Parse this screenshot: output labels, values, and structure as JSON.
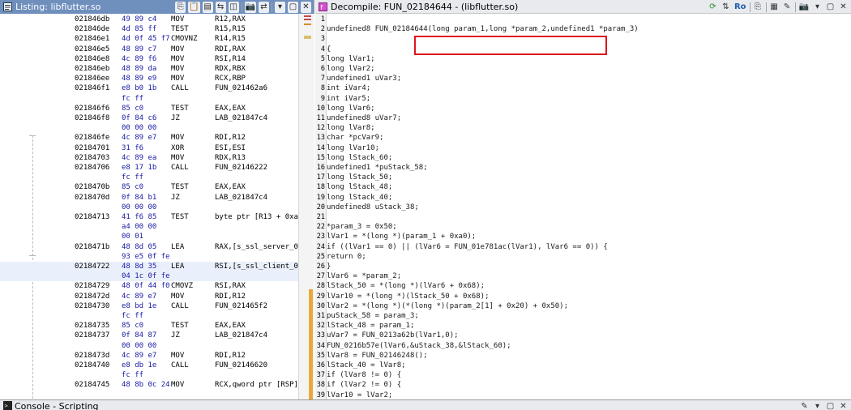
{
  "listing": {
    "title": "Listing:  libflutter.so",
    "rows": [
      {
        "addr": "021846db",
        "bytes": "49 89 c4",
        "mn": "MOV",
        "op": "R12,RAX"
      },
      {
        "addr": "021846de",
        "bytes": "4d 85 ff",
        "mn": "TEST",
        "op": "R15,R15"
      },
      {
        "addr": "021846e1",
        "bytes": "4d 0f 45 f7",
        "mn": "CMOVNZ",
        "op": "R14,R15"
      },
      {
        "addr": "021846e5",
        "bytes": "48 89 c7",
        "mn": "MOV",
        "op": "RDI,RAX"
      },
      {
        "addr": "021846e8",
        "bytes": "4c 89 f6",
        "mn": "MOV",
        "op": "RSI,R14"
      },
      {
        "addr": "021846eb",
        "bytes": "48 89 da",
        "mn": "MOV",
        "op": "RDX,RBX"
      },
      {
        "addr": "021846ee",
        "bytes": "48 89 e9",
        "mn": "MOV",
        "op": "RCX,RBP"
      },
      {
        "addr": "021846f1",
        "bytes": "e8 b0 1b",
        "mn": "CALL",
        "op": "FUN_021462a6"
      },
      {
        "addr": "",
        "bytes": "fc ff",
        "mn": "",
        "op": ""
      },
      {
        "addr": "021846f6",
        "bytes": "85 c0",
        "mn": "TEST",
        "op": "EAX,EAX"
      },
      {
        "addr": "021846f8",
        "bytes": "0f 84 c6",
        "mn": "JZ",
        "op": "LAB_021847c4"
      },
      {
        "addr": "",
        "bytes": "00 00 00",
        "mn": "",
        "op": ""
      },
      {
        "addr": "021846fe",
        "bytes": "4c 89 e7",
        "mn": "MOV",
        "op": "RDI,R12"
      },
      {
        "addr": "02184701",
        "bytes": "31 f6",
        "mn": "XOR",
        "op": "ESI,ESI"
      },
      {
        "addr": "02184703",
        "bytes": "4c 89 ea",
        "mn": "MOV",
        "op": "RDX,R13"
      },
      {
        "addr": "02184706",
        "bytes": "e8 17 1b",
        "mn": "CALL",
        "op": "FUN_02146222"
      },
      {
        "addr": "",
        "bytes": "fc ff",
        "mn": "",
        "op": ""
      },
      {
        "addr": "0218470b",
        "bytes": "85 c0",
        "mn": "TEST",
        "op": "EAX,EAX"
      },
      {
        "addr": "0218470d",
        "bytes": "0f 84 b1",
        "mn": "JZ",
        "op": "LAB_021847c4"
      },
      {
        "addr": "",
        "bytes": "00 00 00",
        "mn": "",
        "op": ""
      },
      {
        "addr": "02184713",
        "bytes": "41 f6 85",
        "mn": "TEST",
        "op": "byte ptr [R13 + 0xa4],"
      },
      {
        "addr": "",
        "bytes": "a4 00 00",
        "mn": "",
        "op": ""
      },
      {
        "addr": "",
        "bytes": "00 01",
        "mn": "",
        "op": ""
      },
      {
        "addr": "0218471b",
        "bytes": "48 8d 05",
        "mn": "LEA",
        "op": "RAX,[s_ssl_server_0028"
      },
      {
        "addr": "",
        "bytes": "93 e5 0f fe",
        "mn": "",
        "op": ""
      },
      {
        "addr": "02184722",
        "bytes": "48 8d 35",
        "mn": "LEA",
        "op": "RSI,[s_ssl_client_0027"
      },
      {
        "addr": "",
        "bytes": "04 1c 0f fe",
        "mn": "",
        "op": ""
      },
      {
        "addr": "02184729",
        "bytes": "48 0f 44 f0",
        "mn": "CMOVZ",
        "op": "RSI,RAX"
      },
      {
        "addr": "0218472d",
        "bytes": "4c 89 e7",
        "mn": "MOV",
        "op": "RDI,R12"
      },
      {
        "addr": "02184730",
        "bytes": "e8 bd 1e",
        "mn": "CALL",
        "op": "FUN_021465f2"
      },
      {
        "addr": "",
        "bytes": "fc ff",
        "mn": "",
        "op": ""
      },
      {
        "addr": "02184735",
        "bytes": "85 c0",
        "mn": "TEST",
        "op": "EAX,EAX"
      },
      {
        "addr": "02184737",
        "bytes": "0f 84 87",
        "mn": "JZ",
        "op": "LAB_021847c4"
      },
      {
        "addr": "",
        "bytes": "00 00 00",
        "mn": "",
        "op": ""
      },
      {
        "addr": "0218473d",
        "bytes": "4c 89 e7",
        "mn": "MOV",
        "op": "RDI,R12"
      },
      {
        "addr": "02184740",
        "bytes": "e8 db 1e",
        "mn": "CALL",
        "op": "FUN_02146620"
      },
      {
        "addr": "",
        "bytes": "fc ff",
        "mn": "",
        "op": ""
      },
      {
        "addr": "02184745",
        "bytes": "48 8b 0c 24",
        "mn": "MOV",
        "op": "RCX,qword ptr [RSP]"
      }
    ]
  },
  "decompile": {
    "title": "Decompile: FUN_02184644 - (libflutter.so)",
    "ro_label": "Ro",
    "lines": [
      "",
      "undefined8 FUN_02184644(long param_1,long *param_2,undefined1 *param_3)",
      "",
      "{",
      "  long lVar1;",
      "  long lVar2;",
      "  undefined1 uVar3;",
      "  int iVar4;",
      "  int iVar5;",
      "  long lVar6;",
      "  undefined8 uVar7;",
      "  long lVar8;",
      "  char *pcVar9;",
      "  long lVar10;",
      "  long lStack_60;",
      "  undefined1 *puStack_58;",
      "  long lStack_50;",
      "  long lStack_48;",
      "  long lStack_40;",
      "  undefined8 uStack_38;",
      "",
      "  *param_3 = 0x50;",
      "  lVar1 = *(long *)(param_1 + 0xa0);",
      "  if ((lVar1 == 0) || (lVar6 = FUN_01e781ac(lVar1), lVar6 == 0)) {",
      "    return 0;",
      "  }",
      "  lVar6 = *param_2;",
      "  lStack_50 = *(long *)(lVar6 + 0x68);",
      "  lVar10 = *(long *)(lStack_50 + 0x68);",
      "  lVar2 = *(long *)(*(long *)(param_2[1] + 0x20) + 0x50);",
      "  puStack_58 = param_3;",
      "  lStack_48 = param_1;",
      "  uVar7 = FUN_0213a62b(lVar1,0);",
      "  FUN_0216b57e(lVar6,&uStack_38,&lStack_60);",
      "  lVar8 = FUN_02146248();",
      "  lStack_40 = lVar8;",
      "  if (lVar8 != 0) {",
      "    if (lVar2 != 0) {",
      "      lVar10 = lVar2;"
    ]
  },
  "console": {
    "title": "Console - Scripting"
  }
}
